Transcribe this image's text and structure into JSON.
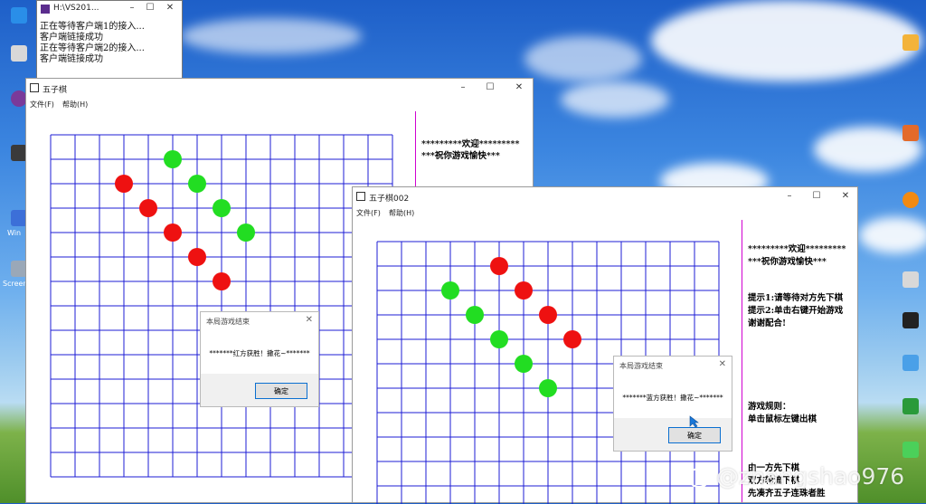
{
  "console": {
    "title": "H:\\VS201...",
    "lines": [
      "正在等待客户端1的接入...",
      "客户端链接成功",
      "正在等待客户端2的接入...",
      "客户端链接成功"
    ]
  },
  "window1": {
    "title": "五子棋",
    "menu": [
      "文件(F)",
      "帮助(H)"
    ],
    "welcome": [
      "*********欢迎*********",
      "***祝你游戏愉快***"
    ],
    "dialog": {
      "title": "本局游戏结束",
      "message": "*******红方获胜！撒花~*******",
      "ok": "确定"
    }
  },
  "window2": {
    "title": "五子棋002",
    "menu": [
      "文件(F)",
      "帮助(H)"
    ],
    "welcome": [
      "*********欢迎*********",
      "***祝你游戏愉快***"
    ],
    "tips": [
      "提示1:请等待对方先下棋",
      "提示2:单击右键开始游戏",
      "谢谢配合!"
    ],
    "rules": [
      "游戏规则：",
      "单击鼠标左键出棋"
    ],
    "rules2": [
      "由一方先下棋",
      "双方轮流下棋",
      "先凑齐五子连珠者胜"
    ],
    "dialog": {
      "title": "本局游戏结束",
      "message": "*******蓝方获胜！撒花~*******",
      "ok": "确定"
    }
  },
  "board1": {
    "red": [
      [
        3,
        2
      ],
      [
        4,
        3
      ],
      [
        5,
        4
      ],
      [
        6,
        5
      ],
      [
        7,
        6
      ]
    ],
    "green": [
      [
        5,
        1
      ],
      [
        6,
        2
      ],
      [
        7,
        3
      ],
      [
        8,
        4
      ]
    ]
  },
  "board2": {
    "red": [
      [
        5,
        1
      ],
      [
        6,
        2
      ],
      [
        7,
        3
      ],
      [
        8,
        4
      ]
    ],
    "green": [
      [
        3,
        2
      ],
      [
        4,
        3
      ],
      [
        5,
        4
      ],
      [
        6,
        5
      ],
      [
        7,
        6
      ]
    ]
  },
  "colors": {
    "grid": "#1c1cd6",
    "red": "#ee1111",
    "green": "#22dd22",
    "divider": "#d000d0"
  },
  "watermark": "@zhangshao976",
  "desktop_labels": [
    "Win",
    "Screen"
  ]
}
